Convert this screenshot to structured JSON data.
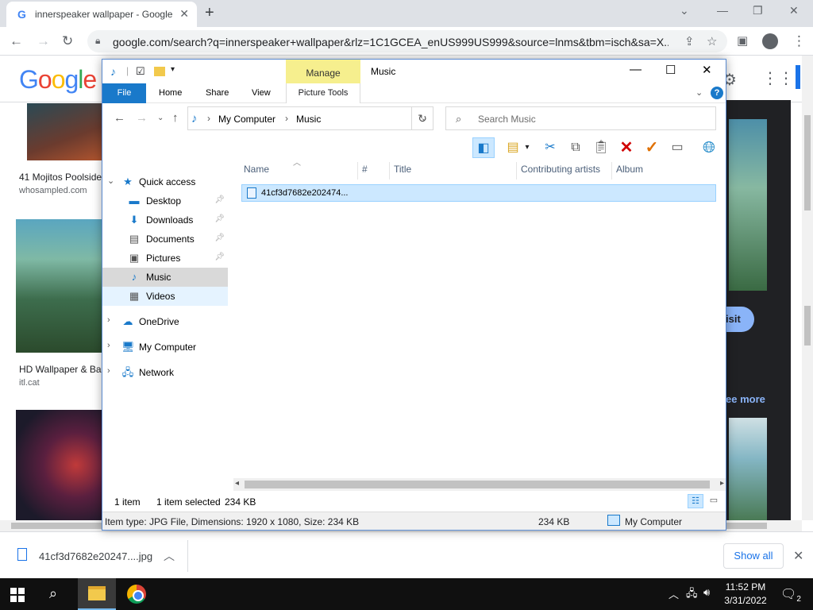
{
  "browser": {
    "tab_title": "innerspeaker wallpaper - Google",
    "tab_close": "✕",
    "new_tab": "+",
    "url": "google.com/search?q=innerspeaker+wallpaper&rlz=1C1GCEA_enUS999US999&source=lnms&tbm=isch&sa=X..."
  },
  "google": {
    "logo": "Google",
    "results": [
      {
        "title": "41 Mojitos Poolside",
        "source": "whosampled.com"
      },
      {
        "title": "HD Wallpaper & Bac",
        "source": "itl.cat"
      }
    ],
    "visit_label": "isit",
    "see_more": "ee more"
  },
  "explorer": {
    "title": "Music",
    "manage_tab": "Manage",
    "ribbon_tabs": {
      "file": "File",
      "home": "Home",
      "share": "Share",
      "view": "View",
      "picture_tools": "Picture Tools"
    },
    "address": {
      "root": "My Computer",
      "current": "Music"
    },
    "search_placeholder": "Search Music",
    "nav": {
      "quick_access": "Quick access",
      "items": [
        {
          "label": "Desktop",
          "icon": "desktop-icon"
        },
        {
          "label": "Downloads",
          "icon": "downloads-icon"
        },
        {
          "label": "Documents",
          "icon": "documents-icon"
        },
        {
          "label": "Pictures",
          "icon": "pictures-icon"
        },
        {
          "label": "Music",
          "icon": "music-icon"
        },
        {
          "label": "Videos",
          "icon": "videos-icon"
        }
      ],
      "onedrive": "OneDrive",
      "my_computer": "My Computer",
      "network": "Network"
    },
    "columns": [
      "Name",
      "#",
      "Title",
      "Contributing artists",
      "Album"
    ],
    "files": [
      {
        "name": "41cf3d7682e202474..."
      }
    ],
    "status": {
      "count": "1 item",
      "selected": "1 item selected",
      "size": "234 KB"
    },
    "details": {
      "info": "Item type: JPG File, Dimensions: 1920 x 1080, Size: 234 KB",
      "size": "234 KB",
      "location": "My Computer"
    }
  },
  "downloads": {
    "file_name": "41cf3d7682e20247....jpg",
    "show_all": "Show all"
  },
  "taskbar": {
    "time": "11:52 PM",
    "date": "3/31/2022",
    "notification_count": "2"
  }
}
